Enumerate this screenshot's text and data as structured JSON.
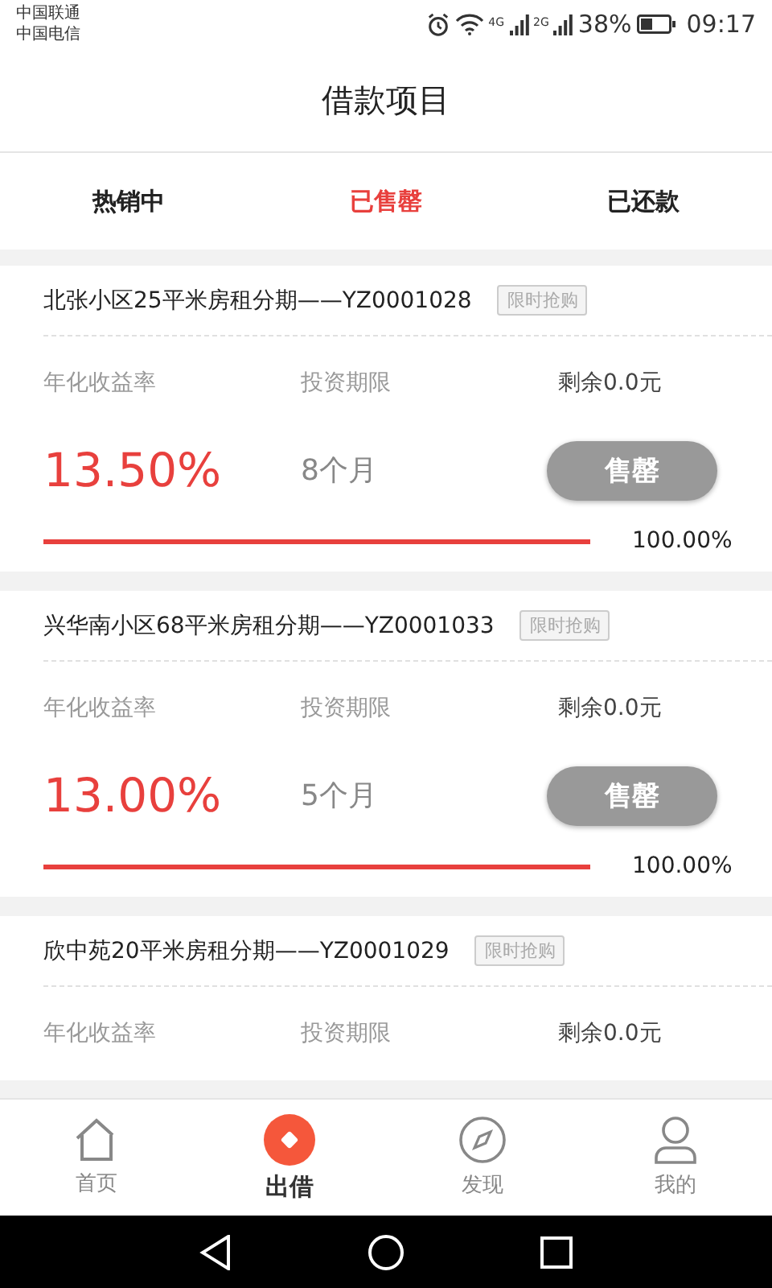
{
  "status_bar": {
    "carriers": [
      "中国联通",
      "中国电信"
    ],
    "networks": [
      "4G",
      "2G"
    ],
    "battery": "38%",
    "time": "09:17"
  },
  "header": {
    "title": "借款项目"
  },
  "tabs": [
    {
      "label": "热销中",
      "selected": false
    },
    {
      "label": "已售罄",
      "selected": true
    },
    {
      "label": "已还款",
      "selected": false
    }
  ],
  "products": [
    {
      "title": "北张小区25平米房租分期——YZ0001028",
      "tag": "限时抢购",
      "rate_label": "年化收益率",
      "term_label": "投资期限",
      "remaining": "剩余0.0元",
      "rate": "13.50%",
      "term": "8个月",
      "button": "售罄",
      "level": 1,
      "progress": "100.00%"
    },
    {
      "title": "兴华南小区68平米房租分期——YZ0001033",
      "tag": "限时抢购",
      "rate_label": "年化收益率",
      "term_label": "投资期限",
      "remaining": "剩余0.0元",
      "rate": "13.00%",
      "term": "5个月",
      "button": "售罄",
      "level": 1,
      "progress": "100.00%"
    },
    {
      "title": "欣中苑20平米房租分期——YZ0001029",
      "tag": "限时抢购",
      "rate_label": "年化收益率",
      "term_label": "投资期限",
      "remaining": "剩余0.0元"
    }
  ],
  "bottom_nav": [
    {
      "label": "首页",
      "selected": false
    },
    {
      "label": "出借",
      "selected": true
    },
    {
      "label": "发现",
      "selected": false
    },
    {
      "label": "我的",
      "selected": false
    }
  ]
}
